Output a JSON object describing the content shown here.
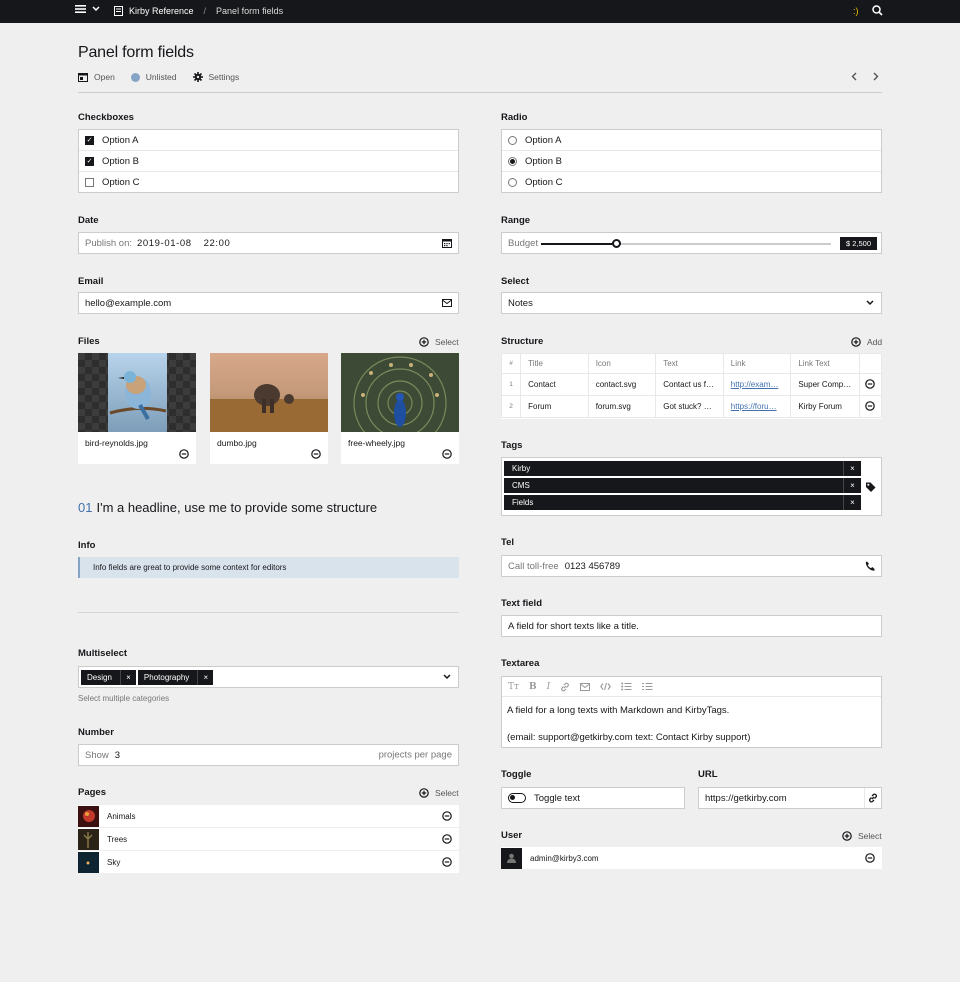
{
  "topbar": {
    "site_name": "Kirby Reference",
    "breadcrumb": "Panel form fields",
    "smile": ":)"
  },
  "page": {
    "title": "Panel form fields",
    "open": "Open",
    "status": "Unlisted",
    "settings": "Settings"
  },
  "checkboxes": {
    "label": "Checkboxes",
    "options": [
      {
        "label": "Option A",
        "checked": true
      },
      {
        "label": "Option B",
        "checked": true
      },
      {
        "label": "Option C",
        "checked": false
      }
    ]
  },
  "radio": {
    "label": "Radio",
    "options": [
      {
        "label": "Option A",
        "checked": false
      },
      {
        "label": "Option B",
        "checked": true
      },
      {
        "label": "Option C",
        "checked": false
      }
    ]
  },
  "date": {
    "label": "Date",
    "prefix": "Publish on:",
    "date": "2019-01-08",
    "time": "22:00"
  },
  "range": {
    "label": "Range",
    "prefix": "Budget",
    "value": "$ 2,500",
    "fraction": 0.26
  },
  "email": {
    "label": "Email",
    "value": "hello@example.com"
  },
  "select": {
    "label": "Select",
    "value": "Notes"
  },
  "files": {
    "label": "Files",
    "select_label": "Select",
    "items": [
      {
        "name": "bird-reynolds.jpg"
      },
      {
        "name": "dumbo.jpg"
      },
      {
        "name": "free-wheely.jpg"
      }
    ]
  },
  "structure": {
    "label": "Structure",
    "add_label": "Add",
    "headers": [
      "#",
      "Title",
      "Icon",
      "Text",
      "Link",
      "Link Text"
    ],
    "rows": [
      [
        "1",
        "Contact",
        "contact.svg",
        "Contact us f…",
        "http://exam…",
        "Super Comp…"
      ],
      [
        "2",
        "Forum",
        "forum.svg",
        "Got stuck? …",
        "https://foru…",
        "Kirby Forum"
      ]
    ]
  },
  "headline": {
    "number": "01",
    "text": "I'm a headline, use me to provide some structure"
  },
  "tags": {
    "label": "Tags",
    "items": [
      "Kirby",
      "CMS",
      "Fields"
    ]
  },
  "info": {
    "label": "Info",
    "text": "Info fields are great to provide some context for editors"
  },
  "tel": {
    "label": "Tel",
    "prefix": "Call toll-free",
    "value": "0123 456789"
  },
  "text_field": {
    "label": "Text field",
    "value": "A field for short texts like a title."
  },
  "multiselect": {
    "label": "Multiselect",
    "tags": [
      "Design",
      "Photography"
    ],
    "help": "Select multiple categories"
  },
  "textarea": {
    "label": "Textarea",
    "line1": "A field for a long texts with Markdown and KirbyTags.",
    "line2": "(email: support@getkirby.com text: Contact Kirby support)"
  },
  "number": {
    "label": "Number",
    "prefix": "Show",
    "value": "3",
    "suffix": "projects per page"
  },
  "toggle": {
    "label": "Toggle",
    "text": "Toggle text"
  },
  "url": {
    "label": "URL",
    "value": "https://getkirby.com"
  },
  "pages": {
    "label": "Pages",
    "select_label": "Select",
    "items": [
      {
        "title": "Animals"
      },
      {
        "title": "Trees"
      },
      {
        "title": "Sky"
      }
    ]
  },
  "user": {
    "label": "User",
    "select_label": "Select",
    "email": "admin@kirby3.com"
  },
  "colors": {
    "topbar": "#16171a",
    "accent": "#4271ae",
    "unlisted": "#85a3c4",
    "info_bg": "#d9e3ec",
    "background": "#efefef"
  }
}
